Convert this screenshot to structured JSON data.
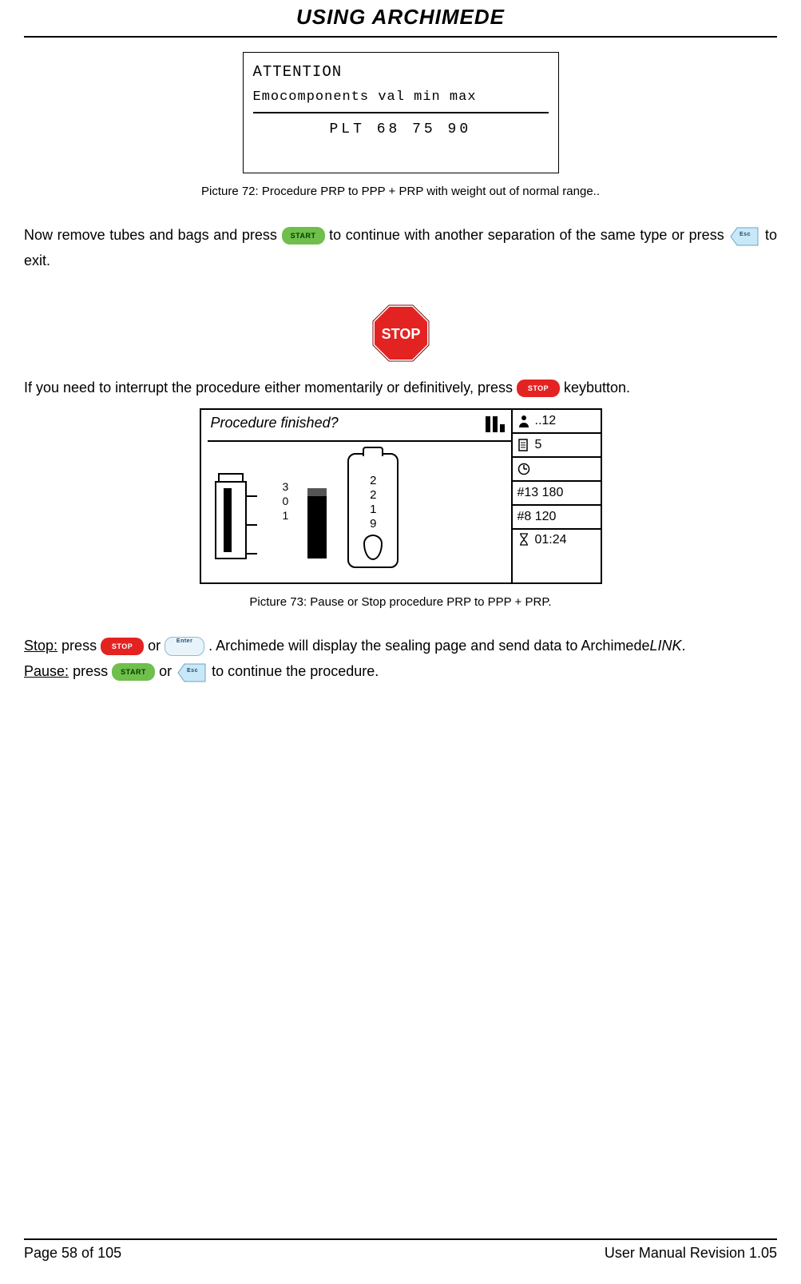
{
  "header": {
    "title": "USING ARCHIMEDE"
  },
  "picture72": {
    "attention": "ATTENTION",
    "row": "Emocomponents val  min   max",
    "plt": "PLT  68  75   90",
    "caption": "Picture 72: Procedure PRP to PPP + PRP with weight out of normal range.."
  },
  "para1": {
    "a": "Now remove tubes and bags and press ",
    "b": " to continue with another separation of the same type or press ",
    "c": " to exit."
  },
  "keys": {
    "start": "START",
    "stop": "STOP",
    "enter": "Enter",
    "esc": "Esc"
  },
  "stop_big": "STOP",
  "para2": {
    "a": "If you need to interrupt the procedure either momentarily or definitively, press ",
    "b": " keybutton."
  },
  "picture73": {
    "top": "Procedure finished?",
    "side_nums": [
      "3",
      "0",
      "1"
    ],
    "tube_nums": [
      "2",
      "2",
      "1",
      "9"
    ],
    "right": {
      "r1": "..12",
      "r2": "5",
      "r3": "",
      "r4": "#13 180",
      "r5": "#8 120",
      "r6": "01:24"
    },
    "caption": "Picture 73: Pause or Stop procedure PRP to PPP + PRP."
  },
  "para3": {
    "stop_label": "Stop:",
    "stop_a": " press ",
    "stop_b": " or ",
    "stop_c": ". Archimede will display the sealing page and send data to Archimede",
    "link": "LINK",
    "stop_d": ".",
    "pause_label": "Pause:",
    "pause_a": " press ",
    "pause_b": " or ",
    "pause_c": " to continue the procedure."
  },
  "footer": {
    "left": "Page 58 of 105",
    "right": "User Manual Revision 1.05"
  }
}
